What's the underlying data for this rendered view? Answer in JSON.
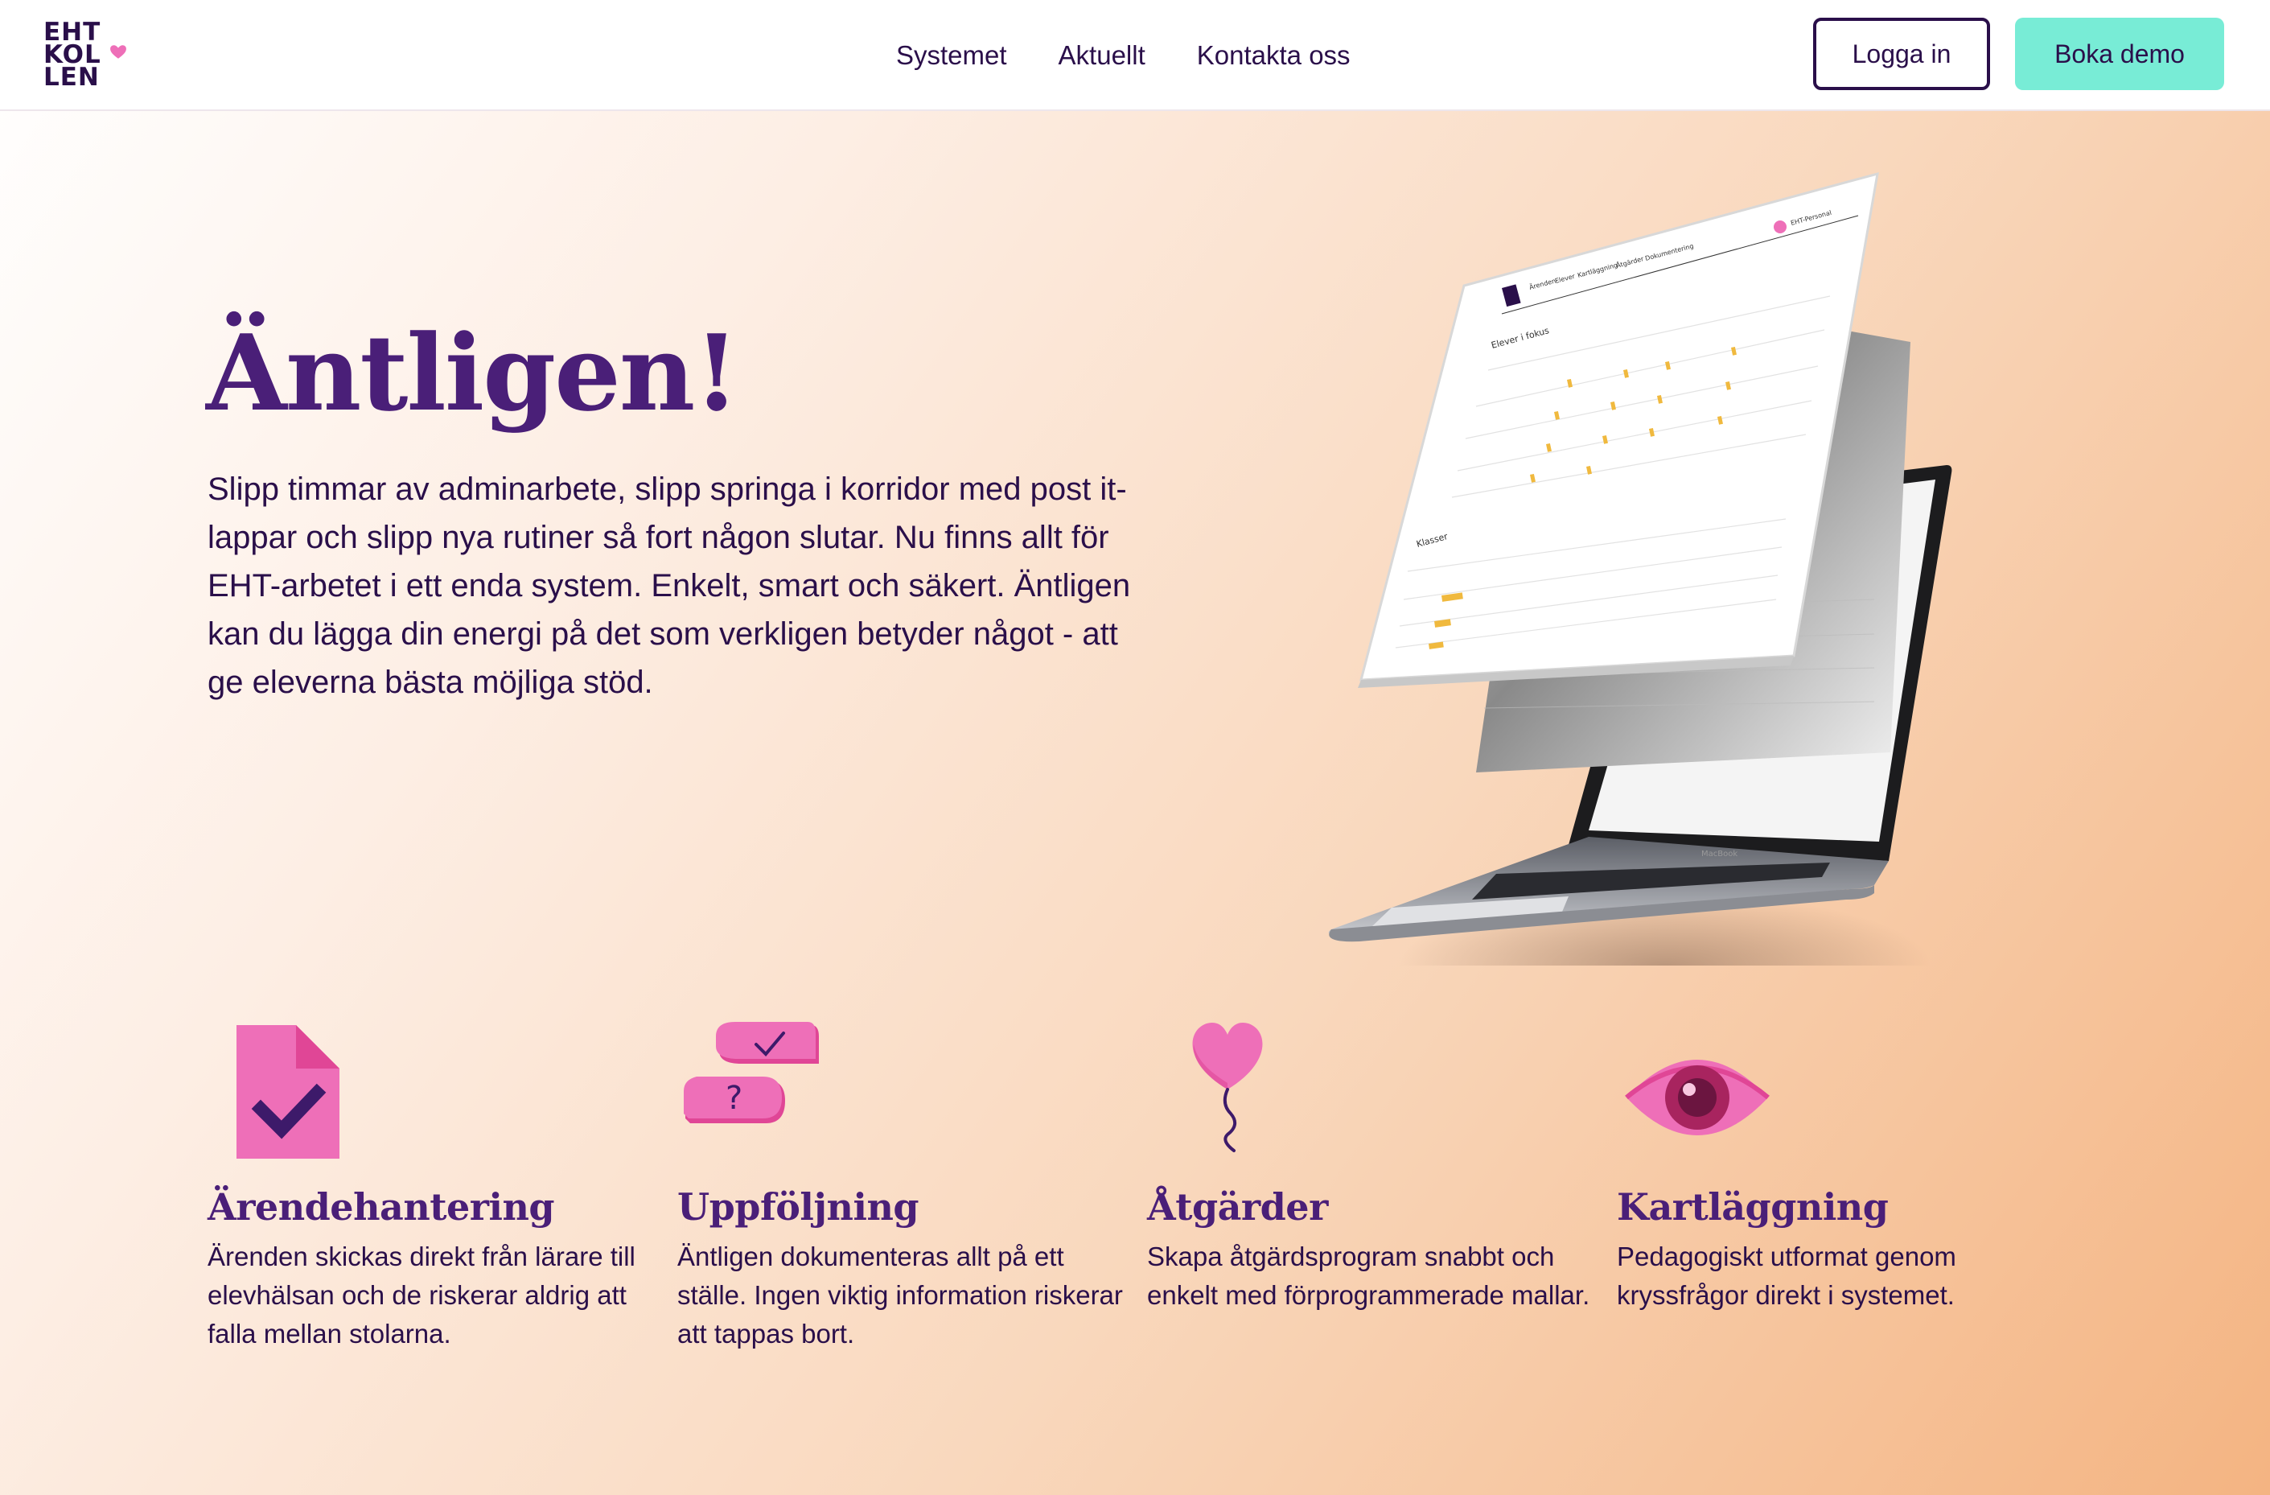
{
  "header": {
    "logo_lines": [
      "EHT",
      "KOL",
      "LEN"
    ],
    "nav": [
      "Systemet",
      "Aktuellt",
      "Kontakta oss"
    ],
    "login_label": "Logga in",
    "demo_label": "Boka demo"
  },
  "hero": {
    "title": "Äntligen!",
    "text": "Slipp timmar av adminarbete, slipp springa i korridor med post it-lappar och slipp nya rutiner så fort någon slutar. Nu finns allt för EHT-arbetet i ett enda system. Enkelt, smart och säkert. Äntligen kan du lägga din energi på det som verkligen betyder något - att ge eleverna bästa möjliga stöd."
  },
  "device": {
    "app_nav": [
      "Ärenden",
      "Elever",
      "Kartläggning",
      "Åtgärder",
      "Dokumentering"
    ],
    "user_label": "EHT-Personal",
    "section_students": "Elever i fokus",
    "section_classes": "Klasser",
    "laptop_brand": "MacBook"
  },
  "features": [
    {
      "icon": "document-check-icon",
      "title": "Ärendehantering",
      "text": "Ärenden skickas direkt från lärare till elevhälsan och de riskerar aldrig att falla mellan stolarna."
    },
    {
      "icon": "chat-bubbles-icon",
      "title": "Uppföljning",
      "text": "Äntligen dokumenteras allt på ett ställe. Ingen viktig information riskerar att tappas bort."
    },
    {
      "icon": "heart-balloon-icon",
      "title": "Åtgärder",
      "text": "Skapa åtgärdsprogram snabbt och enkelt med förprogrammerade mallar."
    },
    {
      "icon": "eye-icon",
      "title": "Kartläggning",
      "text": "Pedagogiskt utformat genom kryssfrågor direkt i systemet."
    }
  ],
  "colors": {
    "primary": "#4a1f78",
    "dark": "#2a0f4a",
    "accent_mint": "#78ecd6",
    "accent_pink": "#ee6fb8"
  }
}
